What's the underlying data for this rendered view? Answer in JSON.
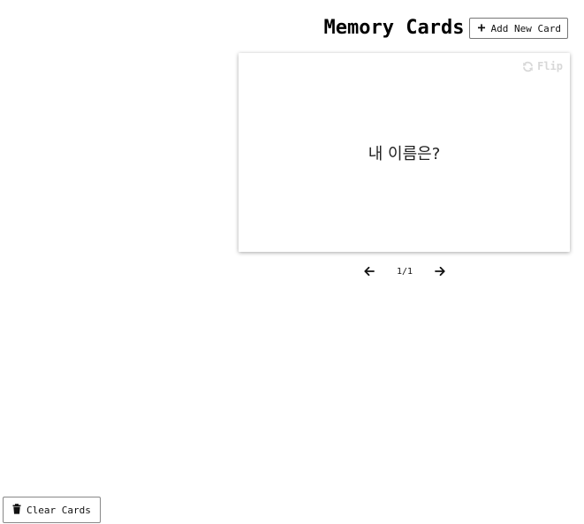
{
  "header": {
    "title": "Memory Cards",
    "add_button_label": "Add New Card"
  },
  "card": {
    "flip_label": "Flip",
    "question": "내 이름은?"
  },
  "pagination": {
    "current": 1,
    "total": 1,
    "label": "1/1"
  },
  "footer": {
    "clear_button_label": "Clear Cards"
  },
  "icons": {
    "add": "plus-icon",
    "flip": "sync-icon",
    "prev": "arrow-left-icon",
    "next": "arrow-right-icon",
    "clear": "trash-icon"
  },
  "colors": {
    "background": "#ffffff",
    "text": "#111111",
    "flip_muted": "#d8d8d8",
    "button_border": "#777777"
  }
}
